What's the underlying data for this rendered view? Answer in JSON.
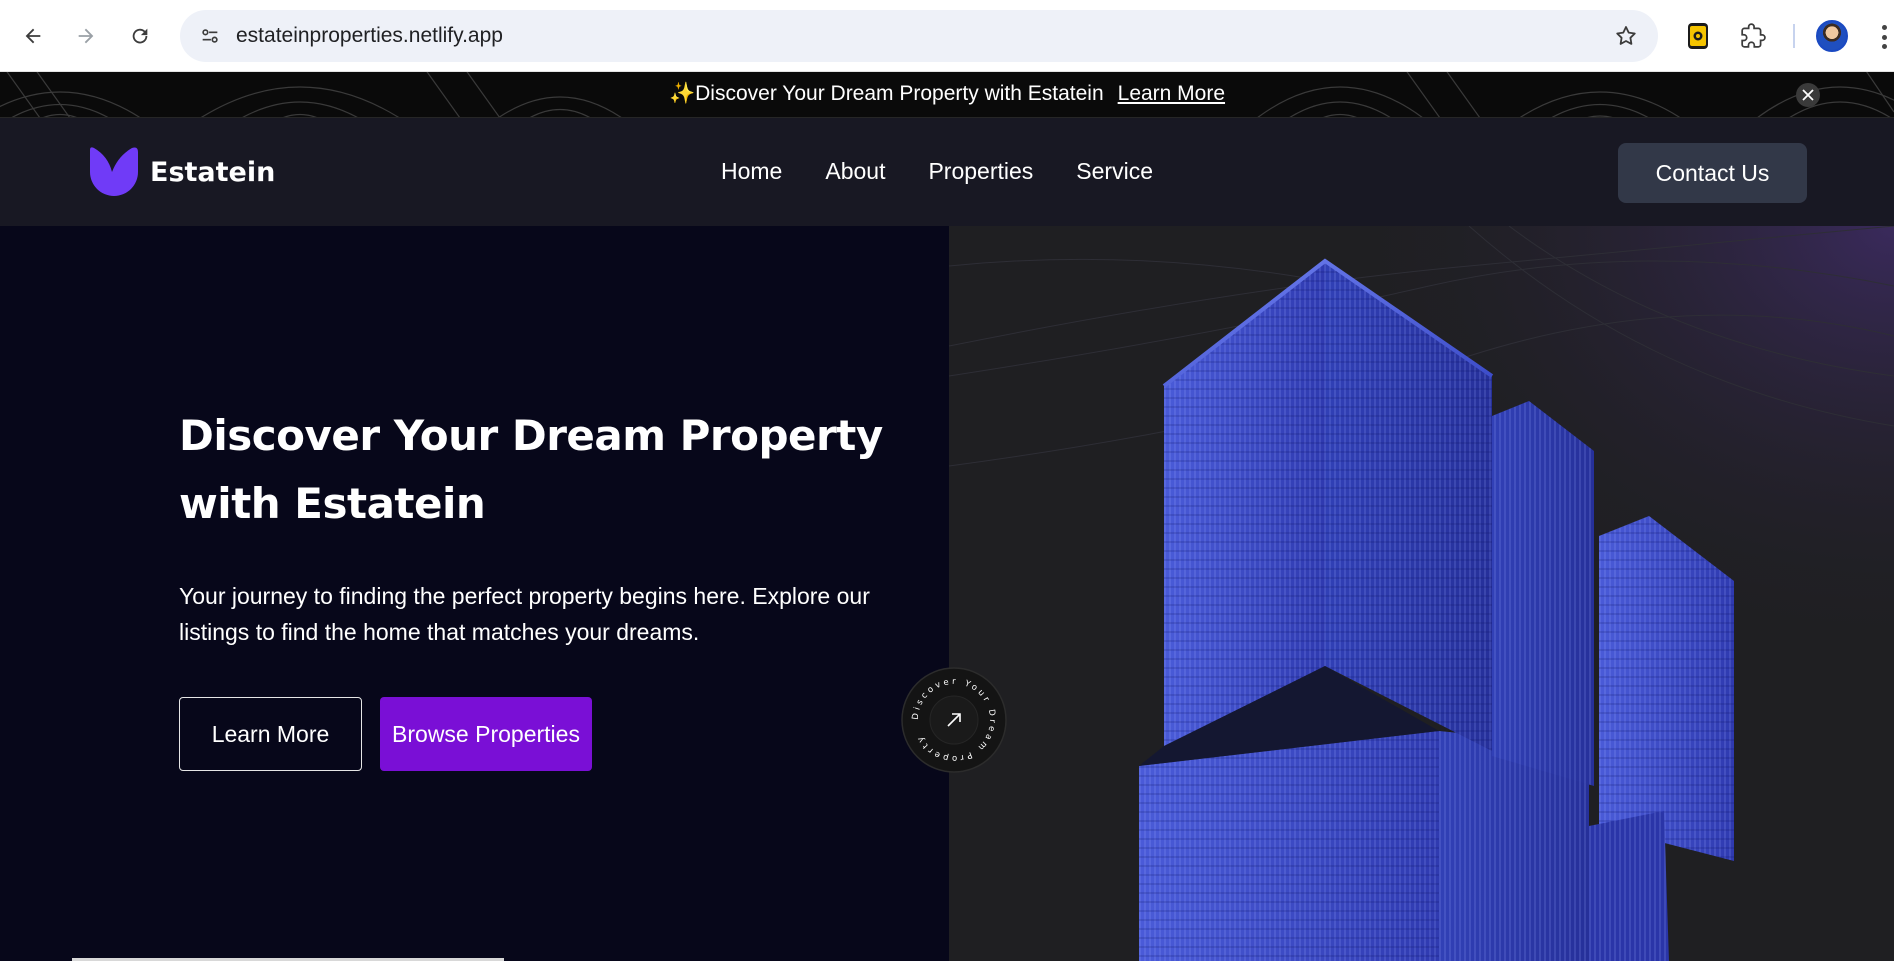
{
  "browser": {
    "url": "estateinproperties.netlify.app",
    "icons": [
      "back-arrow-icon",
      "forward-arrow-icon",
      "reload-icon",
      "site-settings-icon",
      "bookmark-star-icon",
      "extension-icon",
      "puzzle-extensions-icon",
      "profile-avatar",
      "more-menu-icon"
    ]
  },
  "banner": {
    "sparkle": "✨",
    "message": "Discover Your Dream Property with Estatein",
    "link": "Learn More"
  },
  "header": {
    "brand": "Estatein",
    "nav": [
      "Home",
      "About",
      "Properties",
      "Service"
    ],
    "contact": "Contact Us"
  },
  "hero": {
    "title": "Discover Your Dream Property with Estatein",
    "subtitle": "Your journey to finding the perfect property begins here. Explore our listings to find the home that matches your dreams.",
    "learn_more": "Learn More",
    "browse": "Browse Properties",
    "badge_text": "Discover Your Dream Property"
  },
  "colors": {
    "accent": "#7a0fd6",
    "logo": "#703bf7",
    "header_bg": "#181823",
    "hero_bg": "#07071a"
  }
}
